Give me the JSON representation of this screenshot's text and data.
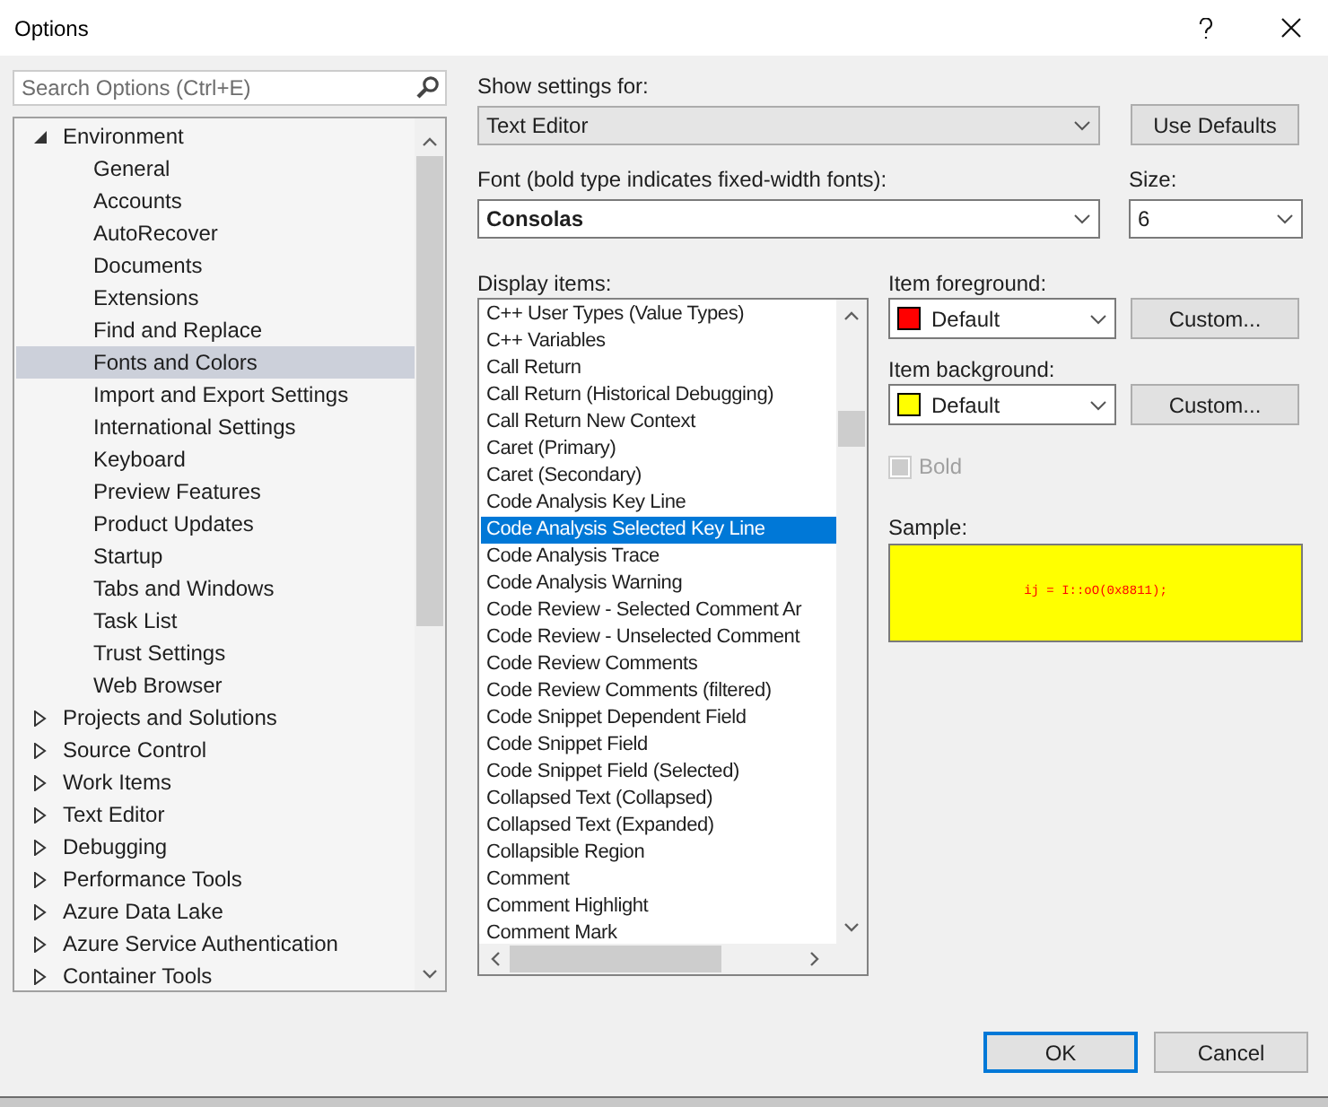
{
  "window": {
    "title": "Options"
  },
  "search": {
    "placeholder": "Search Options (Ctrl+E)"
  },
  "tree": [
    {
      "label": "Environment",
      "expanded": true,
      "selected": false,
      "children": [
        {
          "label": "General",
          "selected": false
        },
        {
          "label": "Accounts",
          "selected": false
        },
        {
          "label": "AutoRecover",
          "selected": false
        },
        {
          "label": "Documents",
          "selected": false
        },
        {
          "label": "Extensions",
          "selected": false
        },
        {
          "label": "Find and Replace",
          "selected": false
        },
        {
          "label": "Fonts and Colors",
          "selected": true
        },
        {
          "label": "Import and Export Settings",
          "selected": false
        },
        {
          "label": "International Settings",
          "selected": false
        },
        {
          "label": "Keyboard",
          "selected": false
        },
        {
          "label": "Preview Features",
          "selected": false
        },
        {
          "label": "Product Updates",
          "selected": false
        },
        {
          "label": "Startup",
          "selected": false
        },
        {
          "label": "Tabs and Windows",
          "selected": false
        },
        {
          "label": "Task List",
          "selected": false
        },
        {
          "label": "Trust Settings",
          "selected": false
        },
        {
          "label": "Web Browser",
          "selected": false
        }
      ]
    },
    {
      "label": "Projects and Solutions",
      "expanded": false,
      "selected": false
    },
    {
      "label": "Source Control",
      "expanded": false,
      "selected": false
    },
    {
      "label": "Work Items",
      "expanded": false,
      "selected": false
    },
    {
      "label": "Text Editor",
      "expanded": false,
      "selected": false
    },
    {
      "label": "Debugging",
      "expanded": false,
      "selected": false
    },
    {
      "label": "Performance Tools",
      "expanded": false,
      "selected": false
    },
    {
      "label": "Azure Data Lake",
      "expanded": false,
      "selected": false
    },
    {
      "label": "Azure Service Authentication",
      "expanded": false,
      "selected": false
    },
    {
      "label": "Container Tools",
      "expanded": false,
      "selected": false
    }
  ],
  "show_settings": {
    "label": "Show settings for:",
    "value": "Text Editor"
  },
  "use_defaults_button": "Use Defaults",
  "font": {
    "label": "Font (bold type indicates fixed-width fonts):",
    "value": "Consolas"
  },
  "size": {
    "label": "Size:",
    "value": "6"
  },
  "display_items": {
    "label": "Display items:",
    "items": [
      {
        "label": "C++ User Types (Value Types)",
        "selected": false
      },
      {
        "label": "C++ Variables",
        "selected": false
      },
      {
        "label": "Call Return",
        "selected": false
      },
      {
        "label": "Call Return (Historical Debugging)",
        "selected": false
      },
      {
        "label": "Call Return New Context",
        "selected": false
      },
      {
        "label": "Caret (Primary)",
        "selected": false
      },
      {
        "label": "Caret (Secondary)",
        "selected": false
      },
      {
        "label": "Code Analysis Key Line",
        "selected": false
      },
      {
        "label": "Code Analysis Selected Key Line",
        "selected": true
      },
      {
        "label": "Code Analysis Trace",
        "selected": false
      },
      {
        "label": "Code Analysis Warning",
        "selected": false
      },
      {
        "label": "Code Review - Selected Comment Ar",
        "selected": false
      },
      {
        "label": "Code Review - Unselected Comment",
        "selected": false
      },
      {
        "label": "Code Review Comments",
        "selected": false
      },
      {
        "label": "Code Review Comments (filtered)",
        "selected": false
      },
      {
        "label": "Code Snippet Dependent Field",
        "selected": false
      },
      {
        "label": "Code Snippet Field",
        "selected": false
      },
      {
        "label": "Code Snippet Field (Selected)",
        "selected": false
      },
      {
        "label": "Collapsed Text (Collapsed)",
        "selected": false
      },
      {
        "label": "Collapsed Text (Expanded)",
        "selected": false
      },
      {
        "label": "Collapsible Region",
        "selected": false
      },
      {
        "label": "Comment",
        "selected": false
      },
      {
        "label": "Comment Highlight",
        "selected": false
      },
      {
        "label": "Comment Mark",
        "selected": false
      }
    ]
  },
  "item_foreground": {
    "label": "Item foreground:",
    "value": "Default",
    "color": "#ff0000",
    "button": "Custom..."
  },
  "item_background": {
    "label": "Item background:",
    "value": "Default",
    "color": "#ffff00",
    "button": "Custom..."
  },
  "bold": {
    "label": "Bold",
    "checked": false,
    "disabled": true
  },
  "sample": {
    "label": "Sample:",
    "text": "ij = I::oO(0x8811);"
  },
  "buttons": [
    {
      "label": "OK",
      "default": true
    },
    {
      "label": "Cancel",
      "default": false
    }
  ]
}
